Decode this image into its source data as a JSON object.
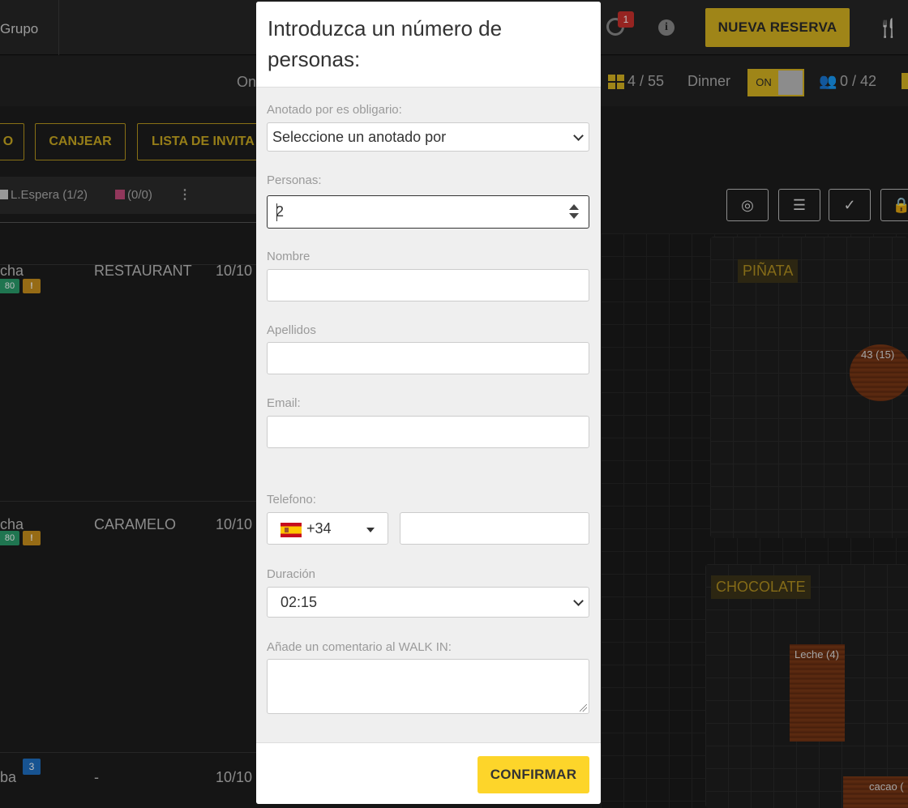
{
  "topbar": {
    "grupo_label": "Grupo",
    "notifications_count": "1",
    "new_reservation_label": "NUEVA RESERVA"
  },
  "subbar": {
    "online_label": "On",
    "tables_count": "4 / 55",
    "service_label": "Dinner",
    "toggle_label": "ON",
    "people_count": "0 / 42"
  },
  "actions": {
    "first_partial": "O",
    "canjear_label": "CANJEAR",
    "lista_label": "LISTA DE INVITA"
  },
  "tabs": {
    "espera_label": "L.Espera (1/2)",
    "pink_label": "(0/0)"
  },
  "list": {
    "rows": [
      {
        "name": "cha",
        "place": "RESTAURANT",
        "date": "10/10",
        "badge": "80"
      },
      {
        "name": "cha",
        "place": "CARAMELO",
        "date": "10/10",
        "badge": "80"
      },
      {
        "name": "ba",
        "place": "-",
        "date": "10/10",
        "badge": "3"
      }
    ]
  },
  "floor": {
    "rooms": [
      {
        "label": "PIÑATA"
      },
      {
        "label": "CHOCOLATE"
      }
    ],
    "tables": [
      {
        "label": "43 (15)"
      },
      {
        "label": "Leche (4)"
      },
      {
        "label": "cacao ("
      }
    ]
  },
  "modal": {
    "title": "Introduzca un número de personas:",
    "anotado_label": "Anotado por es obligario:",
    "anotado_value": "Seleccione un anotado por",
    "personas_label": "Personas:",
    "personas_value": "2",
    "nombre_label": "Nombre",
    "apellidos_label": "Apellidos",
    "email_label": "Email:",
    "telefono_label": "Telefono:",
    "dial_code": "+34",
    "duracion_label": "Duración",
    "duracion_value": "02:15",
    "comentario_label": "Añade un comentario al WALK IN:",
    "confirm_label": "CONFIRMAR"
  },
  "colors": {
    "accent": "#d4b221",
    "confirm": "#fdd52a"
  }
}
